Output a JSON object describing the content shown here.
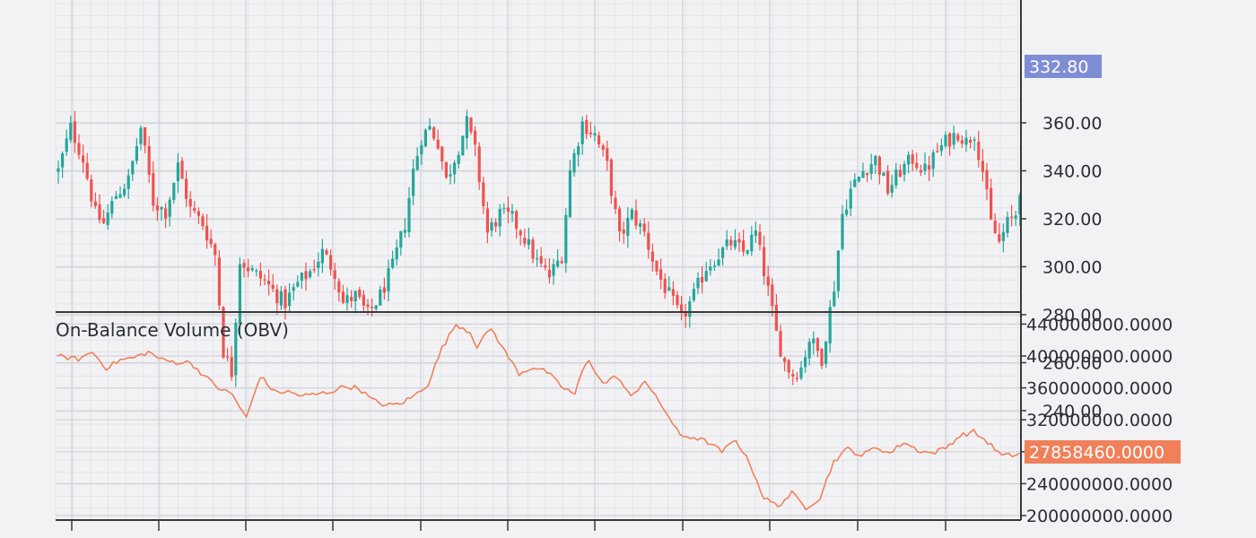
{
  "colors": {
    "background": "#f2f2f4",
    "grid_major": "#cfd2da",
    "grid_minor": "#e3e5ea",
    "up": "#26a69a",
    "down": "#ef5350",
    "obv_line": "#f0805a",
    "price_badge": "#7f8dd4",
    "obv_badge": "#f0805a",
    "text": "#2a2e39",
    "separator": "#3a3a3a"
  },
  "chart_data": [
    {
      "type": "candlestick",
      "title": "",
      "ylim": [
        230,
        365
      ],
      "y_ticks": [
        "240.00",
        "260.00",
        "280.00",
        "300.00",
        "320.00",
        "340.00",
        "360.00"
      ],
      "last_price_label": "332.80",
      "last_price": 332.8,
      "grid": true
    },
    {
      "type": "line",
      "title": "On-Balance Volume (OBV)",
      "ylim": [
        195000000,
        445000000
      ],
      "y_ticks": [
        "200000000.0000",
        "240000000.0000",
        "280000000.0000",
        "320000000.0000",
        "360000000.0000",
        "400000000.0000",
        "440000000.0000"
      ],
      "last_value_label": "27858460.0000",
      "last_value": 278000000,
      "grid": true,
      "series": [
        {
          "anchors": [
            [
              0,
              400000000
            ],
            [
              6,
              396000000
            ],
            [
              10,
              405000000
            ],
            [
              14,
              385000000
            ],
            [
              18,
              395000000
            ],
            [
              22,
              398000000
            ],
            [
              26,
              405000000
            ],
            [
              30,
              395000000
            ],
            [
              34,
              392000000
            ],
            [
              38,
              392000000
            ],
            [
              42,
              375000000
            ],
            [
              46,
              360000000
            ],
            [
              50,
              352000000
            ],
            [
              54,
              322000000
            ],
            [
              58,
              375000000
            ],
            [
              62,
              355000000
            ],
            [
              66,
              355000000
            ],
            [
              70,
              350000000
            ],
            [
              74,
              352000000
            ],
            [
              78,
              355000000
            ],
            [
              82,
              362000000
            ],
            [
              86,
              360000000
            ],
            [
              90,
              345000000
            ],
            [
              94,
              338000000
            ],
            [
              98,
              340000000
            ],
            [
              102,
              350000000
            ],
            [
              106,
              365000000
            ],
            [
              110,
              410000000
            ],
            [
              114,
              440000000
            ],
            [
              118,
              430000000
            ],
            [
              120,
              412000000
            ],
            [
              124,
              435000000
            ],
            [
              128,
              405000000
            ],
            [
              132,
              378000000
            ],
            [
              136,
              386000000
            ],
            [
              140,
              380000000
            ],
            [
              144,
              362000000
            ],
            [
              148,
              352000000
            ],
            [
              150,
              380000000
            ],
            [
              152,
              395000000
            ],
            [
              156,
              365000000
            ],
            [
              160,
              375000000
            ],
            [
              164,
              348000000
            ],
            [
              168,
              370000000
            ],
            [
              170,
              355000000
            ],
            [
              174,
              330000000
            ],
            [
              178,
              300000000
            ],
            [
              182,
              298000000
            ],
            [
              186,
              292000000
            ],
            [
              190,
              280000000
            ],
            [
              194,
              295000000
            ],
            [
              198,
              265000000
            ],
            [
              202,
              222000000
            ],
            [
              206,
              212000000
            ],
            [
              210,
              228000000
            ],
            [
              214,
              210000000
            ],
            [
              218,
              222000000
            ],
            [
              222,
              268000000
            ],
            [
              226,
              284000000
            ],
            [
              230,
              275000000
            ],
            [
              234,
              286000000
            ],
            [
              238,
              278000000
            ],
            [
              242,
              292000000
            ],
            [
              246,
              282000000
            ],
            [
              250,
              278000000
            ],
            [
              254,
              285000000
            ],
            [
              258,
              300000000
            ],
            [
              262,
              305000000
            ],
            [
              266,
              292000000
            ],
            [
              270,
              275000000
            ],
            [
              274,
              276000000
            ],
            [
              275,
              278000000
            ]
          ]
        }
      ]
    }
  ],
  "candles_seed": {
    "anchors": [
      [
        0,
        340
      ],
      [
        3,
        358
      ],
      [
        6,
        345
      ],
      [
        9,
        322
      ],
      [
        11,
        318
      ],
      [
        14,
        330
      ],
      [
        17,
        336
      ],
      [
        20,
        358
      ],
      [
        23,
        327
      ],
      [
        26,
        323
      ],
      [
        29,
        342
      ],
      [
        32,
        324
      ],
      [
        35,
        318
      ],
      [
        38,
        305
      ],
      [
        40,
        265
      ],
      [
        42,
        256
      ],
      [
        44,
        303
      ],
      [
        47,
        298
      ],
      [
        50,
        294
      ],
      [
        53,
        288
      ],
      [
        55,
        285
      ],
      [
        58,
        293
      ],
      [
        61,
        298
      ],
      [
        64,
        306
      ],
      [
        67,
        298
      ],
      [
        69,
        285
      ],
      [
        72,
        288
      ],
      [
        75,
        280
      ],
      [
        78,
        288
      ],
      [
        81,
        300
      ],
      [
        84,
        318
      ],
      [
        86,
        340
      ],
      [
        88,
        354
      ],
      [
        90,
        358
      ],
      [
        92,
        352
      ],
      [
        94,
        336
      ],
      [
        97,
        350
      ],
      [
        99,
        360
      ],
      [
        101,
        348
      ],
      [
        104,
        314
      ],
      [
        107,
        322
      ],
      [
        110,
        320
      ],
      [
        113,
        312
      ],
      [
        116,
        302
      ],
      [
        119,
        296
      ],
      [
        122,
        305
      ],
      [
        124,
        340
      ],
      [
        127,
        360
      ],
      [
        130,
        355
      ],
      [
        133,
        342
      ],
      [
        136,
        312
      ],
      [
        139,
        322
      ],
      [
        142,
        314
      ],
      [
        145,
        298
      ],
      [
        148,
        288
      ],
      [
        151,
        278
      ],
      [
        154,
        288
      ],
      [
        157,
        300
      ],
      [
        160,
        305
      ],
      [
        163,
        310
      ],
      [
        166,
        306
      ],
      [
        169,
        314
      ],
      [
        172,
        290
      ],
      [
        174,
        272
      ],
      [
        176,
        260
      ],
      [
        178,
        255
      ],
      [
        180,
        258
      ],
      [
        182,
        270
      ],
      [
        185,
        262
      ],
      [
        188,
        292
      ],
      [
        190,
        322
      ],
      [
        192,
        332
      ],
      [
        195,
        340
      ],
      [
        198,
        345
      ],
      [
        201,
        332
      ],
      [
        204,
        340
      ],
      [
        207,
        345
      ],
      [
        210,
        340
      ],
      [
        213,
        348
      ],
      [
        215,
        352
      ],
      [
        218,
        356
      ],
      [
        220,
        352
      ],
      [
        222,
        356
      ],
      [
        224,
        340
      ],
      [
        226,
        318
      ],
      [
        228,
        310
      ],
      [
        230,
        318
      ],
      [
        232,
        322
      ],
      [
        233,
        333
      ]
    ]
  }
}
